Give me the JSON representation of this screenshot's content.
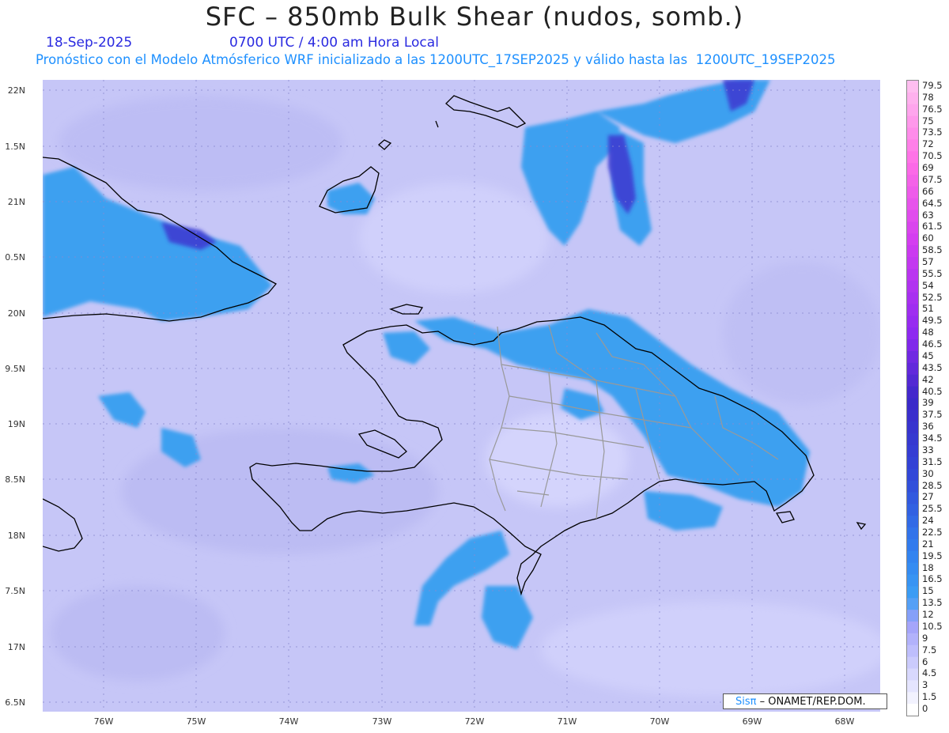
{
  "title": "SFC – 850mb Bulk Shear (nudos, somb.)",
  "date": "18-Sep-2025",
  "time": "0700 UTC / 4:00 am Hora Local",
  "subtitle": "Pronóstico con el Modelo Atmósferico WRF inicializado a las 1200UTC_17SEP2025 y válido hasta las  1200UTC_19SEP2025",
  "lat_labels": [
    "22N",
    "1.5N",
    "21N",
    "0.5N",
    "20N",
    "9.5N",
    "19N",
    "8.5N",
    "18N",
    "7.5N",
    "17N",
    "6.5N"
  ],
  "lon_labels": [
    "76W",
    "75W",
    "74W",
    "73W",
    "72W",
    "71W",
    "70W",
    "69W",
    "68W"
  ],
  "colorbar": {
    "labels": [
      "79.5",
      "78",
      "76.5",
      "75",
      "73.5",
      "72",
      "70.5",
      "69",
      "67.5",
      "66",
      "64.5",
      "63",
      "61.5",
      "60",
      "58.5",
      "57",
      "55.5",
      "54",
      "52.5",
      "51",
      "49.5",
      "48",
      "46.5",
      "45",
      "43.5",
      "42",
      "40.5",
      "39",
      "37.5",
      "36",
      "34.5",
      "33",
      "31.5",
      "30",
      "28.5",
      "27",
      "25.5",
      "24",
      "22.5",
      "21",
      "19.5",
      "18",
      "16.5",
      "15",
      "13.5",
      "12",
      "10.5",
      "9",
      "7.5",
      "6",
      "4.5",
      "3",
      "1.5",
      "0"
    ],
    "colors": {
      "background_light": "#ccccff",
      "low": "#aaaaf5",
      "mid": "#3ca0f0",
      "high": "#3030c8",
      "very_high": "#9b30ff",
      "extreme": "#ff80e0"
    }
  },
  "credit": {
    "logo": "Sisπ",
    "text": "– ONAMET/REP.DOM."
  }
}
